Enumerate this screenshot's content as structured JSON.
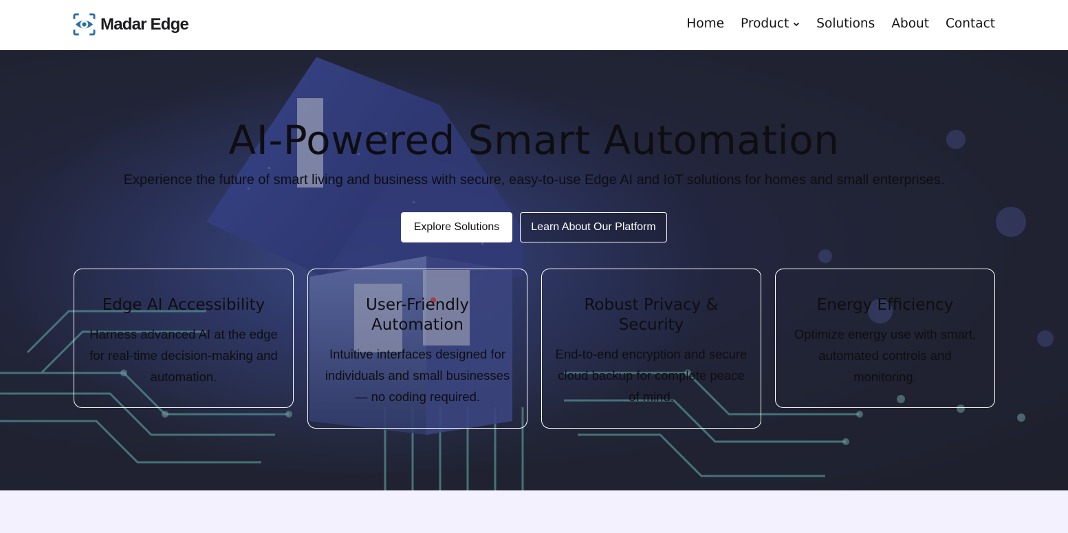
{
  "brand": {
    "name": "Madar Edge",
    "accent": "#2b6fa8"
  },
  "nav": {
    "home": "Home",
    "product": "Product",
    "solutions": "Solutions",
    "about": "About",
    "contact": "Contact"
  },
  "hero": {
    "title": "AI-Powered Smart Automation",
    "subtitle": "Experience the future of smart living and business with secure, easy-to-use Edge AI and IoT solutions for homes and small enterprises.",
    "primary_button": "Explore Solutions",
    "secondary_button": "Learn About Our Platform"
  },
  "features": [
    {
      "title": "Edge AI Accessibility",
      "text": "Harness advanced AI at the edge for real-time decision-making and automation."
    },
    {
      "title": "User-Friendly Automation",
      "text": "Intuitive interfaces designed for individuals and small businesses — no coding required."
    },
    {
      "title": "Robust Privacy & Security",
      "text": "End-to-end encryption and secure cloud backup for complete peace of mind."
    },
    {
      "title": "Energy Efficiency",
      "text": "Optimize energy use with smart, automated controls and monitoring."
    }
  ],
  "icons": {
    "logo": "eye-icon",
    "product_dropdown": "chevron-down-icon"
  }
}
